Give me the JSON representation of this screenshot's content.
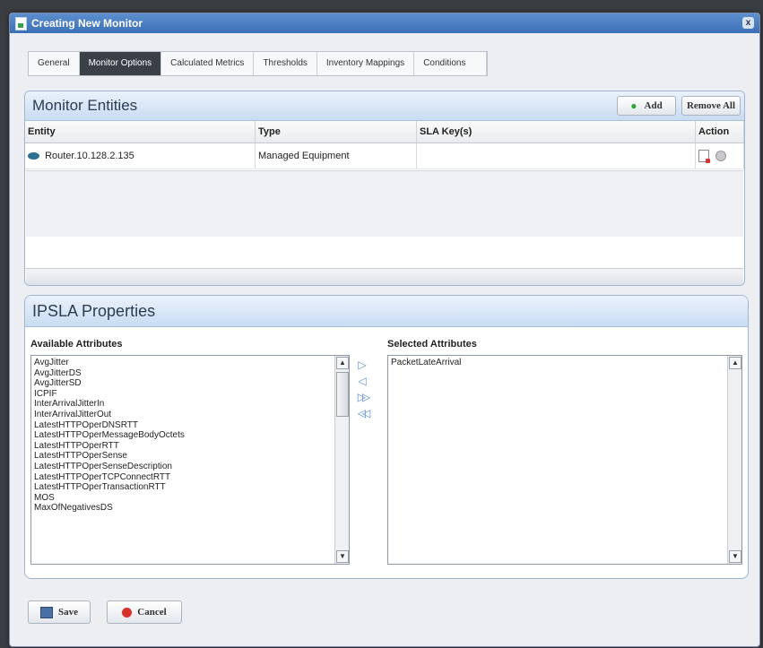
{
  "window": {
    "title": "Creating New Monitor",
    "close_glyph": "x"
  },
  "tabs": [
    {
      "label": "General",
      "active": false
    },
    {
      "label": "Monitor Options",
      "active": true
    },
    {
      "label": "Calculated Metrics",
      "active": false
    },
    {
      "label": "Thresholds",
      "active": false
    },
    {
      "label": "Inventory Mappings",
      "active": false
    },
    {
      "label": "Conditions",
      "active": false
    }
  ],
  "monitor_entities": {
    "title": "Monitor Entities",
    "add_label": "Add",
    "remove_all_label": "Remove All",
    "columns": [
      "Entity",
      "Type",
      "SLA Key(s)",
      "Action"
    ],
    "rows": [
      {
        "entity": "Router.10.128.2.135",
        "type": "Managed Equipment",
        "sla_keys": "",
        "icon": "router-icon"
      }
    ]
  },
  "ipsla": {
    "title": "IPSLA Properties",
    "available_label": "Available Attributes",
    "selected_label": "Selected Attributes",
    "available": [
      "AvgJitter",
      "AvgJitterDS",
      "AvgJitterSD",
      "ICPIF",
      "InterArrivalJitterIn",
      "InterArrivalJitterOut",
      "LatestHTTPOperDNSRTT",
      "LatestHTTPOperMessageBodyOctets",
      "LatestHTTPOperRTT",
      "LatestHTTPOperSense",
      "LatestHTTPOperSenseDescription",
      "LatestHTTPOperTCPConnectRTT",
      "LatestHTTPOperTransactionRTT",
      "MOS",
      "MaxOfNegativesDS"
    ],
    "selected": [
      "PacketLateArrival"
    ],
    "transfer_buttons": [
      "▷",
      "◁",
      "▷▷",
      "◁◁"
    ]
  },
  "footer": {
    "save_label": "Save",
    "cancel_label": "Cancel"
  },
  "colors": {
    "accent": "#3c6fb4",
    "active_tab": "#3b3f46",
    "add_dot": "#2fa53c",
    "cancel_icon": "#d9302c"
  }
}
